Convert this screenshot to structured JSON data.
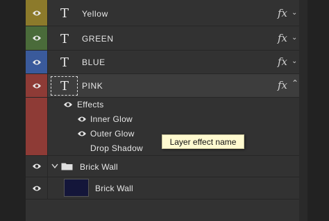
{
  "colors": {
    "yellow": "#8c7a2b",
    "green": "#4a6b3a",
    "blue": "#3a5a9b",
    "red": "#8e3b36",
    "panel": "#323232",
    "selected": "#3d3d3d",
    "tooltip_bg": "#fffad0"
  },
  "layers": {
    "yellow": {
      "name": "Yellow",
      "fx": "fx",
      "icon": "type-icon"
    },
    "green": {
      "name": "GREEN",
      "fx": "fx",
      "icon": "type-icon"
    },
    "blue": {
      "name": "BLUE",
      "fx": "fx",
      "icon": "type-icon"
    },
    "pink": {
      "name": "PINK",
      "fx": "fx",
      "icon": "type-icon"
    },
    "group": {
      "name": "Brick Wall",
      "icon": "folder-icon"
    },
    "brick": {
      "name": "Brick Wall"
    }
  },
  "effects": {
    "title": "Effects",
    "items": [
      "Inner Glow",
      "Outer Glow",
      "Drop Shadow"
    ]
  },
  "tooltip": "Layer effect name",
  "thumb_glyph": "T"
}
